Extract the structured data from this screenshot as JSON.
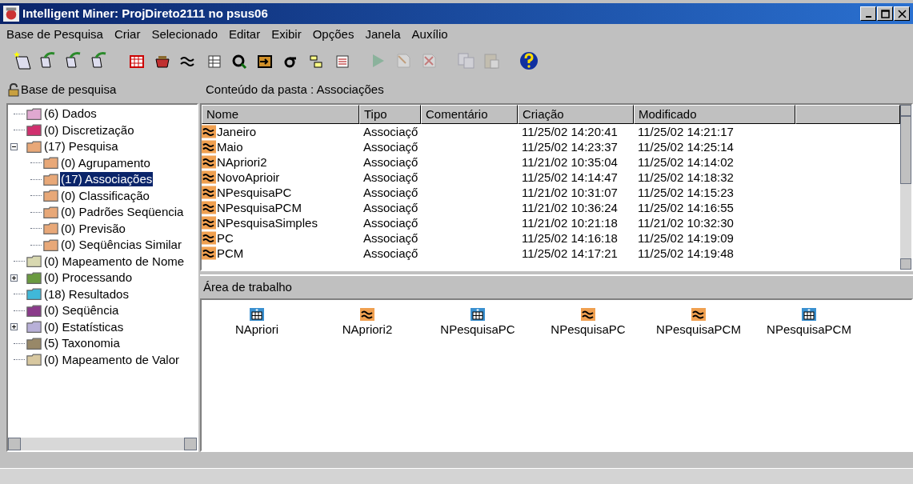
{
  "window": {
    "title": "Intelligent Miner: ProjDireto2111 no psus06"
  },
  "menu": [
    "Base de Pesquisa",
    "Criar",
    "Selecionado",
    "Editar",
    "Exibir",
    "Opções",
    "Janela",
    "Auxílio"
  ],
  "toolbar_groups": [
    [
      {
        "disabled": false
      },
      {
        "disabled": false
      },
      {
        "disabled": false
      },
      {
        "disabled": false
      }
    ],
    [
      {
        "disabled": false
      },
      {
        "disabled": false
      },
      {
        "disabled": false
      },
      {
        "disabled": false
      },
      {
        "disabled": false
      },
      {
        "disabled": false
      },
      {
        "disabled": false
      },
      {
        "disabled": false
      },
      {
        "disabled": false
      }
    ],
    [
      {
        "disabled": true
      },
      {
        "disabled": true
      },
      {
        "disabled": true
      }
    ],
    [
      {
        "disabled": true
      },
      {
        "disabled": true
      }
    ],
    [
      {
        "disabled": false
      }
    ]
  ],
  "tree": {
    "title": "Base de pesquisa",
    "items": [
      {
        "label": "(6) Dados",
        "color": "#e0a8d0",
        "selected": false
      },
      {
        "label": "(0) Discretização",
        "color": "#d0306e",
        "selected": false
      },
      {
        "label": "(17) Pesquisa",
        "color": "#e8a878",
        "selected": false,
        "expanded": true,
        "children": [
          {
            "label": "(0) Agrupamento",
            "color": "#e8a878",
            "selected": false
          },
          {
            "label": "(17) Associações",
            "color": "#e8a878",
            "selected": true
          },
          {
            "label": "(0) Classificação",
            "color": "#e8a878",
            "selected": false
          },
          {
            "label": "(0) Padrões Seqüencia",
            "color": "#e8a878",
            "selected": false
          },
          {
            "label": "(0) Previsão",
            "color": "#e8a878",
            "selected": false
          },
          {
            "label": "(0) Seqüências Similar",
            "color": "#e8a878",
            "selected": false
          }
        ]
      },
      {
        "label": "(0) Mapeamento de Nome",
        "color": "#d8d8b0",
        "selected": false
      },
      {
        "label": "(0) Processando",
        "color": "#6a9a40",
        "selected": false,
        "expanded": false
      },
      {
        "label": "(18) Resultados",
        "color": "#40b8d8",
        "selected": false
      },
      {
        "label": "(0) Seqüência",
        "color": "#8a3a8a",
        "selected": false
      },
      {
        "label": "(0) Estatísticas",
        "color": "#b8b0d8",
        "selected": false,
        "expanded": false
      },
      {
        "label": "(5) Taxonomia",
        "color": "#988868",
        "selected": false
      },
      {
        "label": "(0) Mapeamento de Valor",
        "color": "#d8c8a0",
        "selected": false
      }
    ]
  },
  "folder": {
    "title": "Conteúdo da pasta : Associações",
    "columns": [
      "Nome",
      "Tipo",
      "Comentário",
      "Criação",
      "Modificado"
    ],
    "rows": [
      [
        "Janeiro",
        "Associaçő",
        "",
        "11/25/02  14:20:41",
        "11/25/02  14:21:17"
      ],
      [
        "Maio",
        "Associaçő",
        "",
        "11/25/02  14:23:37",
        "11/25/02  14:25:14"
      ],
      [
        "NApriori2",
        "Associaçő",
        "",
        "11/21/02  10:35:04",
        "11/25/02  14:14:02"
      ],
      [
        "NovoAprioir",
        "Associaçő",
        "",
        "11/25/02  14:14:47",
        "11/25/02  14:18:32"
      ],
      [
        "NPesquisaPC",
        "Associaçő",
        "",
        "11/21/02  10:31:07",
        "11/25/02  14:15:23"
      ],
      [
        "NPesquisaPCM",
        "Associaçő",
        "",
        "11/21/02  10:36:24",
        "11/25/02  14:16:55"
      ],
      [
        "NPesquisaSimples",
        "Associaçő",
        "",
        "11/21/02  10:21:18",
        "11/21/02  10:32:30"
      ],
      [
        "PC",
        "Associaçő",
        "",
        "11/25/02  14:16:18",
        "11/25/02  14:19:09"
      ],
      [
        "PCM",
        "Associaçő",
        "",
        "11/25/02  14:17:21",
        "11/25/02  14:19:48"
      ]
    ]
  },
  "workspace": {
    "title": "Área de trabalho",
    "items": [
      {
        "label": "NApriori",
        "kind": "table"
      },
      {
        "label": "NApriori2",
        "kind": "association"
      },
      {
        "label": "NPesquisaPC",
        "kind": "table"
      },
      {
        "label": "NPesquisaPC",
        "kind": "association"
      },
      {
        "label": "NPesquisaPCM",
        "kind": "association"
      },
      {
        "label": "NPesquisaPCM",
        "kind": "table"
      }
    ]
  }
}
